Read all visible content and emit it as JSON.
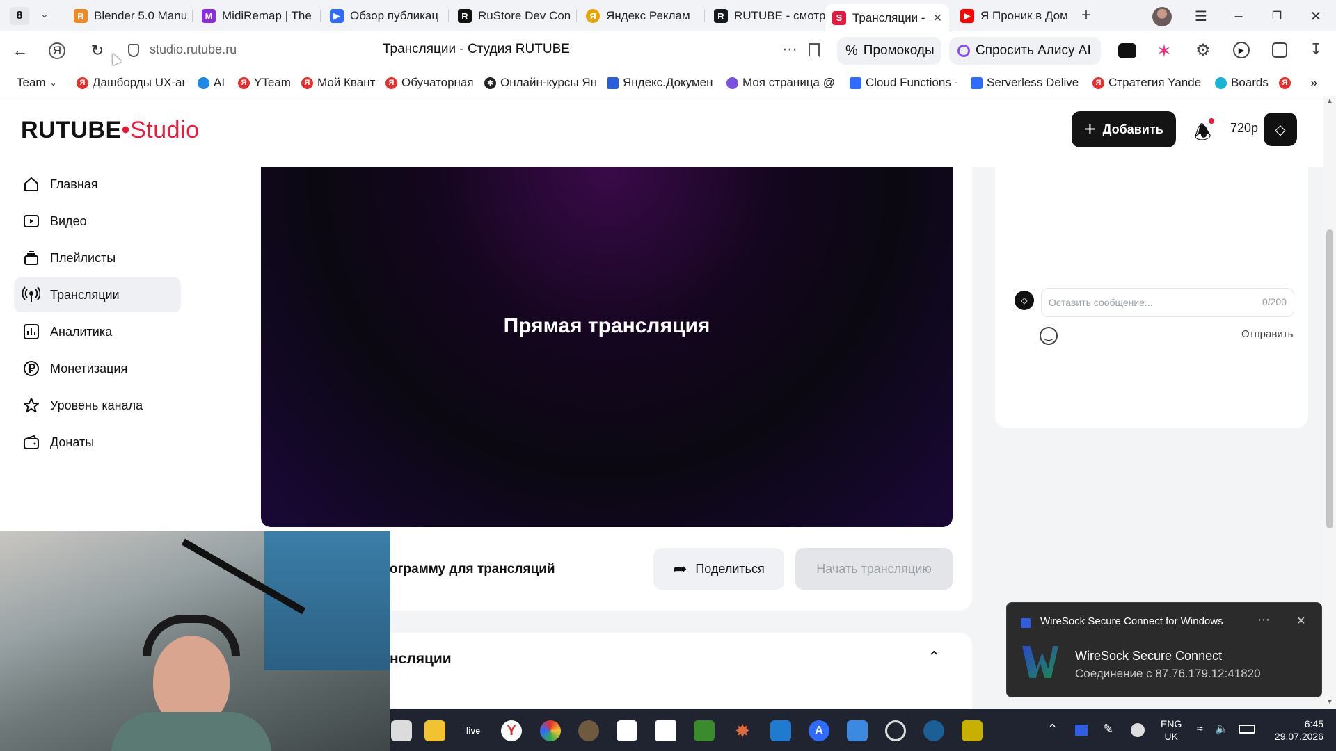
{
  "browser": {
    "tab_count": "8",
    "tabs": [
      {
        "label": "Blender 5.0 Manu",
        "color": "#f08a24",
        "glyph": "B"
      },
      {
        "label": "MidiRemap | The",
        "color": "#8a2be2",
        "glyph": "M"
      },
      {
        "label": "Обзор публикац",
        "color": "#2f6bff",
        "glyph": "▶"
      },
      {
        "label": "RuStore Dev Con",
        "color": "#111111",
        "glyph": "R"
      },
      {
        "label": "Яндекс Реклам",
        "color": "#e8a400",
        "glyph": "Я"
      },
      {
        "label": "RUTUBE - смотр",
        "color": "#14191f",
        "glyph": "R"
      },
      {
        "label": "Трансляции -",
        "color": "#e8173e",
        "glyph": "S"
      },
      {
        "label": "Я Проник в Дом",
        "color": "#ff0000",
        "glyph": "▶"
      }
    ],
    "url": "studio.rutube.ru",
    "page_title": "Трансляции - Студия RUTUBE",
    "promo_label": "Промокоды",
    "alice_label": "Спросить Алису AI",
    "bookmarks": [
      {
        "label": "Team",
        "color": "#ffffff"
      },
      {
        "label": "Дашборды UX-ан",
        "color": "#e52e2e"
      },
      {
        "label": "AI",
        "color": "#1e88e5"
      },
      {
        "label": "YTeam",
        "color": "#e52e2e"
      },
      {
        "label": "Мой Квант",
        "color": "#e52e2e"
      },
      {
        "label": "Обучаторная",
        "color": "#e52e2e"
      },
      {
        "label": "Онлайн-курсы Ян",
        "color": "#222222"
      },
      {
        "label": "Яндекс.Докумен",
        "color": "#2b5fd9"
      },
      {
        "label": "Моя страница @",
        "color": "#7b4fe0"
      },
      {
        "label": "Cloud Functions -",
        "color": "#2f6bff"
      },
      {
        "label": "Serverless Deliver",
        "color": "#2f6bff"
      },
      {
        "label": "Стратегия Yande",
        "color": "#e52e2e"
      },
      {
        "label": "Boards",
        "color": "#1ab3d6"
      }
    ]
  },
  "studio": {
    "logo_main": "RUTUBE",
    "logo_sub": "Studio",
    "add_button": "Добавить",
    "quality": "720p",
    "nav": [
      {
        "label": "Главная",
        "icon": "home-icon"
      },
      {
        "label": "Видео",
        "icon": "video-icon"
      },
      {
        "label": "Плейлисты",
        "icon": "playlist-icon"
      },
      {
        "label": "Трансляции",
        "icon": "broadcast-icon"
      },
      {
        "label": "Аналитика",
        "icon": "analytics-icon"
      },
      {
        "label": "Монетизация",
        "icon": "ruble-icon"
      },
      {
        "label": "Уровень канала",
        "icon": "star-icon"
      },
      {
        "label": "Донаты",
        "icon": "wallet-icon"
      }
    ],
    "player_title": "Прямая трансляция",
    "software_text": "ограмму для трансляций",
    "share_button": "Поделиться",
    "start_button": "Начать трансляцию",
    "section_title": "нсляции",
    "chat": {
      "placeholder": "Оставить сообщение...",
      "counter": "0/200",
      "send_label": "Отправить"
    }
  },
  "toast": {
    "app_name": "WireSock Secure Connect for Windows",
    "title": "WireSock Secure Connect",
    "message": "Соединение с  87.76.179.12:41820"
  },
  "taskbar": {
    "lang_top": "ENG",
    "lang_bottom": "UK",
    "time": "6:45",
    "date": "29.07.2026"
  },
  "colors": {
    "brand_red": "#ed1b3b",
    "dark_button": "#141414",
    "disabled_button": "#e3e5e8"
  }
}
